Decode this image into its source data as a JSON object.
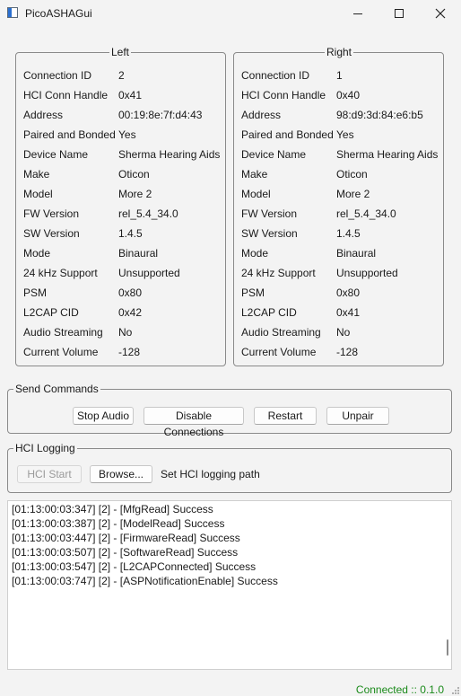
{
  "window": {
    "title": "PicoASHAGui",
    "minimize_icon": "minimize-icon",
    "maximize_icon": "maximize-icon",
    "close_icon": "close-icon"
  },
  "left": {
    "title": "Left",
    "rows": [
      {
        "label": "Connection ID",
        "value": "2"
      },
      {
        "label": "HCI Conn Handle",
        "value": "0x41"
      },
      {
        "label": "Address",
        "value": "00:19:8e:7f:d4:43"
      },
      {
        "label": "Paired and Bonded",
        "value": "Yes"
      },
      {
        "label": "Device Name",
        "value": "Sherma Hearing Aids"
      },
      {
        "label": "Make",
        "value": "Oticon"
      },
      {
        "label": "Model",
        "value": "More 2"
      },
      {
        "label": "FW Version",
        "value": "rel_5.4_34.0"
      },
      {
        "label": "SW Version",
        "value": "1.4.5"
      },
      {
        "label": "Mode",
        "value": "Binaural"
      },
      {
        "label": "24 kHz Support",
        "value": "Unsupported"
      },
      {
        "label": "PSM",
        "value": "0x80"
      },
      {
        "label": "L2CAP CID",
        "value": "0x42"
      },
      {
        "label": "Audio Streaming",
        "value": "No"
      },
      {
        "label": "Current Volume",
        "value": "-128"
      }
    ]
  },
  "right": {
    "title": "Right",
    "rows": [
      {
        "label": "Connection ID",
        "value": "1"
      },
      {
        "label": "HCI Conn Handle",
        "value": "0x40"
      },
      {
        "label": "Address",
        "value": "98:d9:3d:84:e6:b5"
      },
      {
        "label": "Paired and Bonded",
        "value": "Yes"
      },
      {
        "label": "Device Name",
        "value": "Sherma Hearing Aids"
      },
      {
        "label": "Make",
        "value": "Oticon"
      },
      {
        "label": "Model",
        "value": "More 2"
      },
      {
        "label": "FW Version",
        "value": "rel_5.4_34.0"
      },
      {
        "label": "SW Version",
        "value": "1.4.5"
      },
      {
        "label": "Mode",
        "value": "Binaural"
      },
      {
        "label": "24 kHz Support",
        "value": "Unsupported"
      },
      {
        "label": "PSM",
        "value": "0x80"
      },
      {
        "label": "L2CAP CID",
        "value": "0x41"
      },
      {
        "label": "Audio Streaming",
        "value": "No"
      },
      {
        "label": "Current Volume",
        "value": "-128"
      }
    ]
  },
  "send_commands": {
    "title": "Send Commands",
    "stop_audio": "Stop Audio",
    "disable_connections": "Disable Connections",
    "restart": "Restart",
    "unpair": "Unpair"
  },
  "hci_logging": {
    "title": "HCI Logging",
    "start": "HCI Start",
    "browse": "Browse...",
    "path_label": "Set HCI logging path"
  },
  "log": [
    "[01:13:00:03:347] [2] - [MfgRead] Success",
    "[01:13:00:03:387] [2] - [ModelRead] Success",
    "[01:13:00:03:447] [2] - [FirmwareRead] Success",
    "[01:13:00:03:507] [2] - [SoftwareRead] Success",
    "[01:13:00:03:547] [2] - [L2CAPConnected] Success",
    "[01:13:00:03:747] [2] - [ASPNotificationEnable] Success"
  ],
  "status": {
    "text": "Connected :: 0.1.0",
    "color": "#1a8a1a"
  }
}
